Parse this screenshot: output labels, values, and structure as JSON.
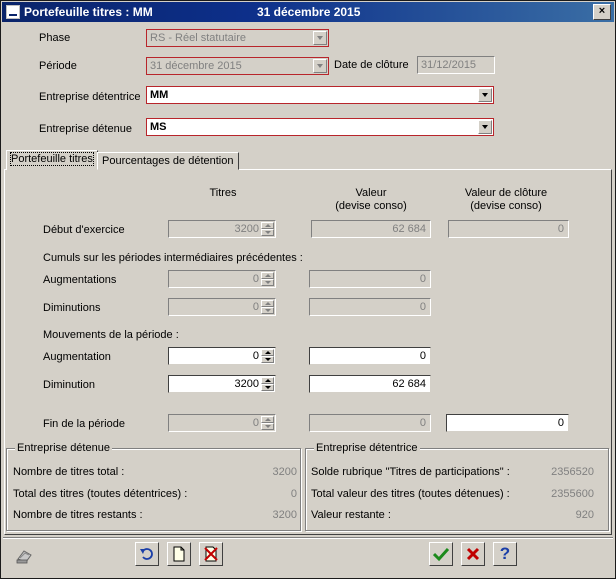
{
  "window": {
    "title": "Portefeuille titres : MM",
    "date": "31 décembre 2015",
    "close_label": "×"
  },
  "form": {
    "phase_label": "Phase",
    "phase_value": "RS - Réel statutaire",
    "periode_label": "Période",
    "periode_value": "31 décembre 2015",
    "date_cloture_label": "Date de clôture",
    "date_cloture_value": "31/12/2015",
    "detentrice_label": "Entreprise détentrice",
    "detentrice_value": "MM",
    "detenue_label": "Entreprise détenue",
    "detenue_value": "MS"
  },
  "tabs": [
    {
      "label": "Portefeuille titres",
      "active": true
    },
    {
      "label": "Pourcentages de détention",
      "active": false
    }
  ],
  "grid": {
    "col_titres": "Titres",
    "col_valeur_1": "Valeur",
    "col_valeur_2": "(devise conso)",
    "col_cloture_1": "Valeur de clôture",
    "col_cloture_2": "(devise conso)",
    "debut_label": "Début d'exercice",
    "debut_titres": "3200",
    "debut_valeur": "62 684",
    "debut_cloture": "0",
    "cumuls_label": "Cumuls sur les périodes intermédiaires précédentes :",
    "cum_aug_label": "Augmentations",
    "cum_aug_titres": "0",
    "cum_aug_valeur": "0",
    "cum_dim_label": "Diminutions",
    "cum_dim_titres": "0",
    "cum_dim_valeur": "0",
    "mouv_label": "Mouvements de la période :",
    "mouv_aug_label": "Augmentation",
    "mouv_aug_titres": "0",
    "mouv_aug_valeur": "0",
    "mouv_dim_label": "Diminution",
    "mouv_dim_titres": "3200",
    "mouv_dim_valeur": "62 684",
    "fin_label": "Fin de la période",
    "fin_titres": "0",
    "fin_valeur": "0",
    "fin_cloture": "0"
  },
  "group_detenue": {
    "title": "Entreprise détenue",
    "rows": [
      {
        "label": "Nombre de titres total :",
        "value": "3200"
      },
      {
        "label": "Total des titres (toutes détentrices) :",
        "value": "0"
      },
      {
        "label": "Nombre de titres restants :",
        "value": "3200"
      }
    ]
  },
  "group_detentrice": {
    "title": "Entreprise détentrice",
    "rows": [
      {
        "label": "Solde rubrique \"Titres de participations\" :",
        "value": "2356520"
      },
      {
        "label": "Total valeur des titres (toutes détenues) :",
        "value": "2355600"
      },
      {
        "label": "Valeur restante :",
        "value": "920"
      }
    ]
  },
  "toolbar": {
    "icons": [
      "print-icon",
      "undo-icon",
      "new-document-icon",
      "delete-document-icon",
      "ok-check-icon",
      "cancel-x-icon",
      "help-question-icon"
    ],
    "help_glyph": "?",
    "colors": {
      "ok": "#1c8a1c",
      "cancel": "#c00000",
      "help": "#1a3ea8"
    }
  }
}
